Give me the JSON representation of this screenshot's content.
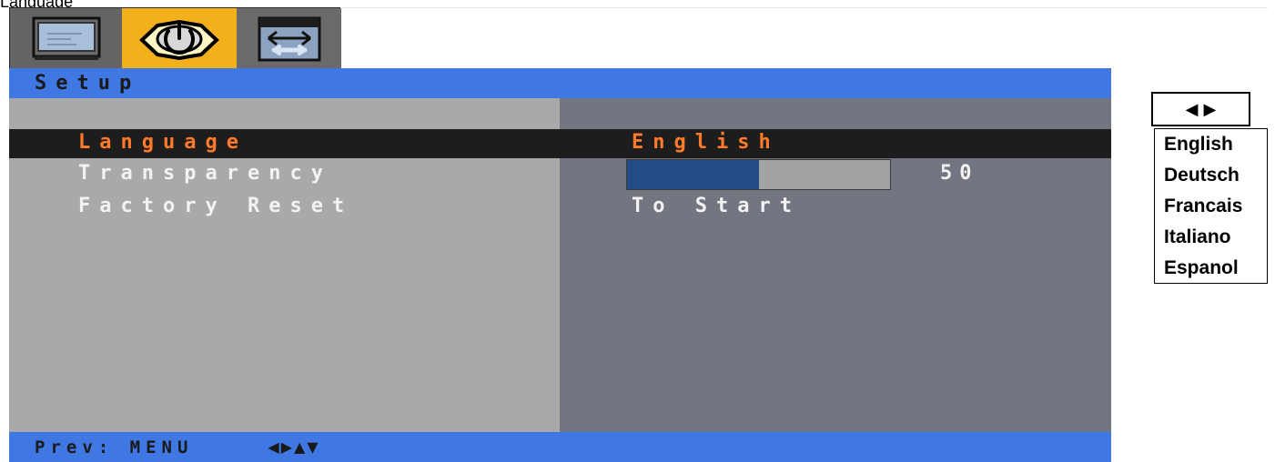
{
  "page": {
    "title": "Language"
  },
  "tabs": [
    {
      "name": "Picture",
      "icon": "monitor-icon",
      "active": false
    },
    {
      "name": "Setup",
      "icon": "setup-icon",
      "active": true
    },
    {
      "name": "Size",
      "icon": "resize-icon",
      "active": false
    }
  ],
  "window": {
    "title": "Setup"
  },
  "menu": {
    "language": {
      "label": "Language",
      "value": "English",
      "selected": true
    },
    "transparency": {
      "label": "Transparency",
      "value": "50",
      "level": 50
    },
    "factory_reset": {
      "label": "Factory Reset",
      "value": "To Start"
    }
  },
  "footer": {
    "prev_label": "Prev: MENU",
    "nav_arrows": "◀▶▲▼"
  },
  "language_selector": {
    "arrows": {
      "left": "◀",
      "right": "▶"
    },
    "options": [
      "English",
      "Deutsch",
      "Francais",
      "Italiano",
      "Espanol"
    ]
  },
  "colors": {
    "accent_blue": "#3f78e2",
    "setup_gold": "#f2b01a",
    "selected_orange": "#ff7b2a"
  }
}
